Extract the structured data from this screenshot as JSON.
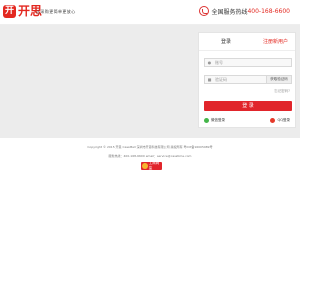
{
  "header": {
    "logo_mark": "开",
    "logo_text": "开思",
    "slogan": "让采购更简单更放心",
    "hotline_label": "全国服务热线",
    "hotline_number": "400-168-6600"
  },
  "login": {
    "tab_login": "登录",
    "tab_register": "注册新用户",
    "username_placeholder": "账号",
    "password_placeholder": "验证码",
    "code_button": "获取验证码",
    "forgot": "忘记密码?",
    "submit": "登 录",
    "wechat_label": "微信登录",
    "qq_label": "QQ登录"
  },
  "footer": {
    "copyright": "Copyright © 2015 开思 CassMall  深圳市开思科技有限公司 版权所有 粤ICP备16005989号",
    "contact": "服务热线：400-168-6600    email：service@casstime.com",
    "badge": "工商网监"
  },
  "colors": {
    "brand": "#e32820",
    "banner_bg": "#ececec"
  },
  "icons": {
    "user": "user-icon",
    "lock": "lock-icon",
    "phone": "phone-icon",
    "wechat": "wechat-icon",
    "qq": "qq-icon"
  }
}
